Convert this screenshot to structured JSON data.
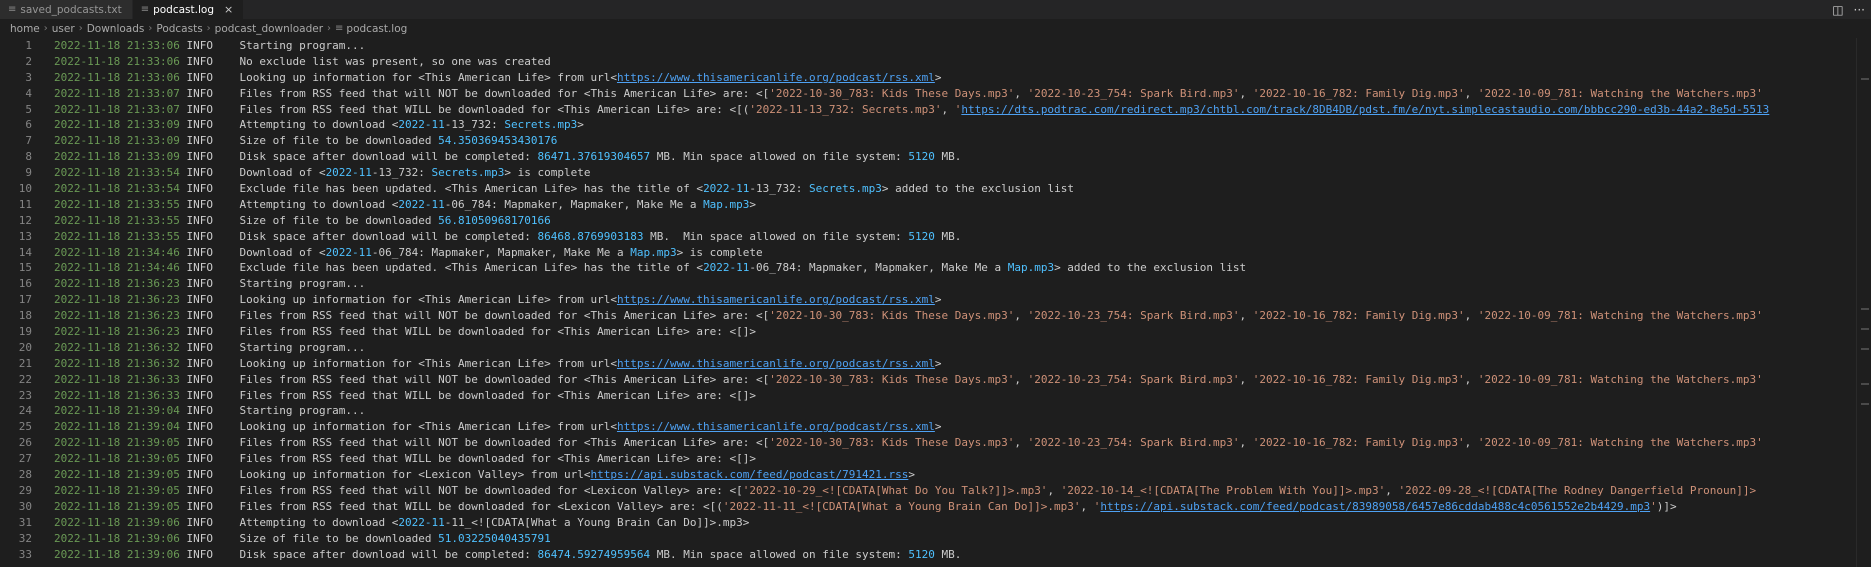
{
  "tabs": [
    {
      "label": "saved_podcasts.txt",
      "active": false,
      "icon": "text-file-icon"
    },
    {
      "label": "podcast.log",
      "active": true,
      "icon": "text-file-icon",
      "close": "×"
    }
  ],
  "tab_actions": {
    "split": "◫",
    "more": "···"
  },
  "breadcrumb": [
    "home",
    "user",
    "Downloads",
    "Podcasts",
    "podcast_downloader",
    "podcast.log"
  ],
  "breadcrumb_separator": "›",
  "colors": {
    "timestamp": "#6a9955",
    "number": "#4fc1ff",
    "url": "#4ea1f3",
    "string": "#ce9178",
    "text": "#cccccc"
  },
  "lines": [
    {
      "n": "1",
      "ts": "2022-11-18 21:33:06",
      "lvl": "INFO",
      "seg": [
        [
          "t",
          "Starting program..."
        ]
      ]
    },
    {
      "n": "2",
      "ts": "2022-11-18 21:33:06",
      "lvl": "INFO",
      "seg": [
        [
          "t",
          "No exclude list was present, so one was created"
        ]
      ]
    },
    {
      "n": "3",
      "ts": "2022-11-18 21:33:06",
      "lvl": "INFO",
      "seg": [
        [
          "t",
          "Looking up information for <This American Life> from url<"
        ],
        [
          "u",
          "https://www.thisamericanlife.org/podcast/rss.xml"
        ],
        [
          "t",
          ">"
        ]
      ]
    },
    {
      "n": "4",
      "ts": "2022-11-18 21:33:07",
      "lvl": "INFO",
      "seg": [
        [
          "t",
          "Files from RSS feed that will NOT be downloaded for <This American Life> are: <["
        ],
        [
          "s",
          "'2022-10-30_783: Kids These Days.mp3'"
        ],
        [
          "t",
          ", "
        ],
        [
          "s",
          "'2022-10-23_754: Spark Bird.mp3'"
        ],
        [
          "t",
          ", "
        ],
        [
          "s",
          "'2022-10-16_782: Family Dig.mp3'"
        ],
        [
          "t",
          ", "
        ],
        [
          "s",
          "'2022-10-09_781: Watching the Watchers.mp3'"
        ]
      ]
    },
    {
      "n": "5",
      "ts": "2022-11-18 21:33:07",
      "lvl": "INFO",
      "seg": [
        [
          "t",
          "Files from RSS feed that WILL be downloaded for <This American Life> are: <[("
        ],
        [
          "s",
          "'2022-11-13_732: Secrets.mp3'"
        ],
        [
          "t",
          ", "
        ],
        [
          "s",
          "'"
        ],
        [
          "u",
          "https://dts.podtrac.com/redirect.mp3/chtbl.com/track/8DB4DB/pdst.fm/e/nyt.simplecastaudio.com/bbbcc290-ed3b-44a2-8e5d-5513"
        ]
      ]
    },
    {
      "n": "6",
      "ts": "2022-11-18 21:33:09",
      "lvl": "INFO",
      "seg": [
        [
          "t",
          "Attempting to download <"
        ],
        [
          "n",
          "2022-11"
        ],
        [
          "t",
          "-13_732: "
        ],
        [
          "n",
          "Secrets.mp3"
        ],
        [
          "t",
          ">"
        ]
      ]
    },
    {
      "n": "7",
      "ts": "2022-11-18 21:33:09",
      "lvl": "INFO",
      "seg": [
        [
          "t",
          "Size of file to be downloaded "
        ],
        [
          "n",
          "54.350369453430176"
        ]
      ]
    },
    {
      "n": "8",
      "ts": "2022-11-18 21:33:09",
      "lvl": "INFO",
      "seg": [
        [
          "t",
          "Disk space after download will be completed: "
        ],
        [
          "n",
          "86471.37619304657"
        ],
        [
          "t",
          " MB. Min space allowed on file system: "
        ],
        [
          "n",
          "5120"
        ],
        [
          "t",
          " MB."
        ]
      ]
    },
    {
      "n": "9",
      "ts": "2022-11-18 21:33:54",
      "lvl": "INFO",
      "seg": [
        [
          "t",
          "Download of <"
        ],
        [
          "n",
          "2022-11"
        ],
        [
          "t",
          "-13_732: "
        ],
        [
          "n",
          "Secrets.mp3"
        ],
        [
          "t",
          "> is complete"
        ]
      ]
    },
    {
      "n": "10",
      "ts": "2022-11-18 21:33:54",
      "lvl": "INFO",
      "seg": [
        [
          "t",
          "Exclude file has been updated. <This American Life> has the title of <"
        ],
        [
          "n",
          "2022-11"
        ],
        [
          "t",
          "-13_732: "
        ],
        [
          "n",
          "Secrets.mp3"
        ],
        [
          "t",
          "> added to the exclusion list"
        ]
      ]
    },
    {
      "n": "11",
      "ts": "2022-11-18 21:33:55",
      "lvl": "INFO",
      "seg": [
        [
          "t",
          "Attempting to download <"
        ],
        [
          "n",
          "2022-11"
        ],
        [
          "t",
          "-06_784: Mapmaker, Mapmaker, Make Me a "
        ],
        [
          "n",
          "Map.mp3"
        ],
        [
          "t",
          ">"
        ]
      ]
    },
    {
      "n": "12",
      "ts": "2022-11-18 21:33:55",
      "lvl": "INFO",
      "seg": [
        [
          "t",
          "Size of file to be downloaded "
        ],
        [
          "n",
          "56.81050968170166"
        ]
      ]
    },
    {
      "n": "13",
      "ts": "2022-11-18 21:33:55",
      "lvl": "INFO",
      "seg": [
        [
          "t",
          "Disk space after download will be completed: "
        ],
        [
          "n",
          "86468.8769903183"
        ],
        [
          "t",
          " MB.  Min space allowed on file system: "
        ],
        [
          "n",
          "5120"
        ],
        [
          "t",
          " MB."
        ]
      ]
    },
    {
      "n": "14",
      "ts": "2022-11-18 21:34:46",
      "lvl": "INFO",
      "seg": [
        [
          "t",
          "Download of <"
        ],
        [
          "n",
          "2022-11"
        ],
        [
          "t",
          "-06_784: Mapmaker, Mapmaker, Make Me a "
        ],
        [
          "n",
          "Map.mp3"
        ],
        [
          "t",
          "> is complete"
        ]
      ]
    },
    {
      "n": "15",
      "ts": "2022-11-18 21:34:46",
      "lvl": "INFO",
      "seg": [
        [
          "t",
          "Exclude file has been updated. <This American Life> has the title of <"
        ],
        [
          "n",
          "2022-11"
        ],
        [
          "t",
          "-06_784: Mapmaker, Mapmaker, Make Me a "
        ],
        [
          "n",
          "Map.mp3"
        ],
        [
          "t",
          "> added to the exclusion list"
        ]
      ]
    },
    {
      "n": "16",
      "ts": "2022-11-18 21:36:23",
      "lvl": "INFO",
      "seg": [
        [
          "t",
          "Starting program..."
        ]
      ]
    },
    {
      "n": "17",
      "ts": "2022-11-18 21:36:23",
      "lvl": "INFO",
      "seg": [
        [
          "t",
          "Looking up information for <This American Life> from url<"
        ],
        [
          "u",
          "https://www.thisamericanlife.org/podcast/rss.xml"
        ],
        [
          "t",
          ">"
        ]
      ]
    },
    {
      "n": "18",
      "ts": "2022-11-18 21:36:23",
      "lvl": "INFO",
      "seg": [
        [
          "t",
          "Files from RSS feed that will NOT be downloaded for <This American Life> are: <["
        ],
        [
          "s",
          "'2022-10-30_783: Kids These Days.mp3'"
        ],
        [
          "t",
          ", "
        ],
        [
          "s",
          "'2022-10-23_754: Spark Bird.mp3'"
        ],
        [
          "t",
          ", "
        ],
        [
          "s",
          "'2022-10-16_782: Family Dig.mp3'"
        ],
        [
          "t",
          ", "
        ],
        [
          "s",
          "'2022-10-09_781: Watching the Watchers.mp3'"
        ]
      ]
    },
    {
      "n": "19",
      "ts": "2022-11-18 21:36:23",
      "lvl": "INFO",
      "seg": [
        [
          "t",
          "Files from RSS feed that WILL be downloaded for <This American Life> are: <[]>"
        ]
      ]
    },
    {
      "n": "20",
      "ts": "2022-11-18 21:36:32",
      "lvl": "INFO",
      "seg": [
        [
          "t",
          "Starting program..."
        ]
      ]
    },
    {
      "n": "21",
      "ts": "2022-11-18 21:36:32",
      "lvl": "INFO",
      "seg": [
        [
          "t",
          "Looking up information for <This American Life> from url<"
        ],
        [
          "u",
          "https://www.thisamericanlife.org/podcast/rss.xml"
        ],
        [
          "t",
          ">"
        ]
      ]
    },
    {
      "n": "22",
      "ts": "2022-11-18 21:36:33",
      "lvl": "INFO",
      "seg": [
        [
          "t",
          "Files from RSS feed that will NOT be downloaded for <This American Life> are: <["
        ],
        [
          "s",
          "'2022-10-30_783: Kids These Days.mp3'"
        ],
        [
          "t",
          ", "
        ],
        [
          "s",
          "'2022-10-23_754: Spark Bird.mp3'"
        ],
        [
          "t",
          ", "
        ],
        [
          "s",
          "'2022-10-16_782: Family Dig.mp3'"
        ],
        [
          "t",
          ", "
        ],
        [
          "s",
          "'2022-10-09_781: Watching the Watchers.mp3'"
        ]
      ]
    },
    {
      "n": "23",
      "ts": "2022-11-18 21:36:33",
      "lvl": "INFO",
      "seg": [
        [
          "t",
          "Files from RSS feed that WILL be downloaded for <This American Life> are: <[]>"
        ]
      ]
    },
    {
      "n": "24",
      "ts": "2022-11-18 21:39:04",
      "lvl": "INFO",
      "seg": [
        [
          "t",
          "Starting program..."
        ]
      ]
    },
    {
      "n": "25",
      "ts": "2022-11-18 21:39:04",
      "lvl": "INFO",
      "seg": [
        [
          "t",
          "Looking up information for <This American Life> from url<"
        ],
        [
          "u",
          "https://www.thisamericanlife.org/podcast/rss.xml"
        ],
        [
          "t",
          ">"
        ]
      ]
    },
    {
      "n": "26",
      "ts": "2022-11-18 21:39:05",
      "lvl": "INFO",
      "seg": [
        [
          "t",
          "Files from RSS feed that will NOT be downloaded for <This American Life> are: <["
        ],
        [
          "s",
          "'2022-10-30_783: Kids These Days.mp3'"
        ],
        [
          "t",
          ", "
        ],
        [
          "s",
          "'2022-10-23_754: Spark Bird.mp3'"
        ],
        [
          "t",
          ", "
        ],
        [
          "s",
          "'2022-10-16_782: Family Dig.mp3'"
        ],
        [
          "t",
          ", "
        ],
        [
          "s",
          "'2022-10-09_781: Watching the Watchers.mp3'"
        ]
      ]
    },
    {
      "n": "27",
      "ts": "2022-11-18 21:39:05",
      "lvl": "INFO",
      "seg": [
        [
          "t",
          "Files from RSS feed that WILL be downloaded for <This American Life> are: <[]>"
        ]
      ]
    },
    {
      "n": "28",
      "ts": "2022-11-18 21:39:05",
      "lvl": "INFO",
      "seg": [
        [
          "t",
          "Looking up information for <Lexicon Valley> from url<"
        ],
        [
          "u",
          "https://api.substack.com/feed/podcast/791421.rss"
        ],
        [
          "t",
          ">"
        ]
      ]
    },
    {
      "n": "29",
      "ts": "2022-11-18 21:39:05",
      "lvl": "INFO",
      "seg": [
        [
          "t",
          "Files from RSS feed that will NOT be downloaded for <Lexicon Valley> are: <["
        ],
        [
          "s",
          "'2022-10-29_<![CDATA[What Do You Talk?]]>.mp3'"
        ],
        [
          "t",
          ", "
        ],
        [
          "s",
          "'2022-10-14_<![CDATA[The Problem With You]]>.mp3'"
        ],
        [
          "t",
          ", "
        ],
        [
          "s",
          "'2022-09-28_<![CDATA[The Rodney Dangerfield Pronoun]]>"
        ]
      ]
    },
    {
      "n": "30",
      "ts": "2022-11-18 21:39:05",
      "lvl": "INFO",
      "seg": [
        [
          "t",
          "Files from RSS feed that WILL be downloaded for <Lexicon Valley> are: <[("
        ],
        [
          "s",
          "'2022-11-11_<![CDATA[What a Young Brain Can Do]]>.mp3'"
        ],
        [
          "t",
          ", "
        ],
        [
          "s",
          "'"
        ],
        [
          "u",
          "https://api.substack.com/feed/podcast/83989058/6457e86cddab488c4c0561552e2b4429.mp3"
        ],
        [
          "s",
          "'"
        ],
        [
          "t",
          ")]>"
        ]
      ]
    },
    {
      "n": "31",
      "ts": "2022-11-18 21:39:06",
      "lvl": "INFO",
      "seg": [
        [
          "t",
          "Attempting to download <"
        ],
        [
          "n",
          "2022-11"
        ],
        [
          "t",
          "-11_<![CDATA[What a Young Brain Can Do]]>.mp3>"
        ]
      ]
    },
    {
      "n": "32",
      "ts": "2022-11-18 21:39:06",
      "lvl": "INFO",
      "seg": [
        [
          "t",
          "Size of file to be downloaded "
        ],
        [
          "n",
          "51.03225040435791"
        ]
      ]
    },
    {
      "n": "33",
      "ts": "2022-11-18 21:39:06",
      "lvl": "INFO",
      "seg": [
        [
          "t",
          "Disk space after download will be completed: "
        ],
        [
          "n",
          "86474.59274959564"
        ],
        [
          "t",
          " MB. Min space allowed on file system: "
        ],
        [
          "n",
          "5120"
        ],
        [
          "t",
          " MB."
        ]
      ]
    }
  ]
}
